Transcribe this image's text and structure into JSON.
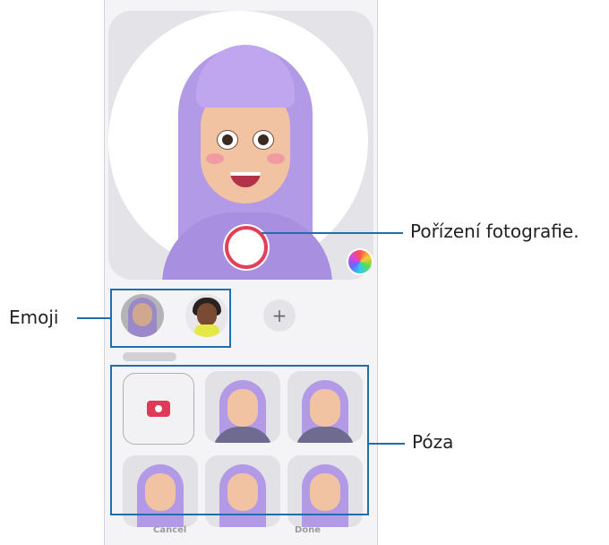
{
  "callouts": {
    "capture": "Pořízení fotografie.",
    "emoji": "Emoji",
    "pose": "Póza"
  },
  "emoji_add_label": "+",
  "bottom_bar": {
    "cancel": "Cancel",
    "done": "Done"
  },
  "colors": {
    "accent_blue": "#1f6fae",
    "shutter_red": "#e0405a",
    "hair_purple": "#b39ae6"
  },
  "icons": {
    "shutter": "shutter-button",
    "color_palette": "color-palette-icon",
    "add": "plus-icon",
    "camera": "camera-icon"
  }
}
